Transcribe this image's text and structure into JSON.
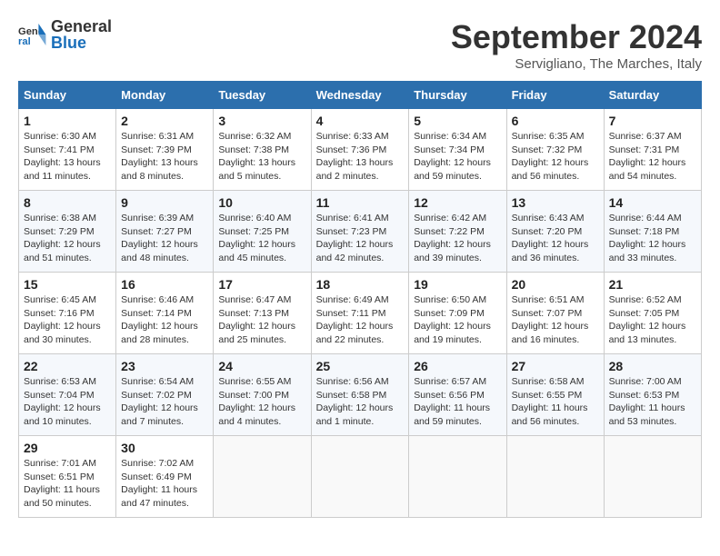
{
  "header": {
    "logo_line1": "General",
    "logo_line2": "Blue",
    "month_title": "September 2024",
    "subtitle": "Servigliano, The Marches, Italy"
  },
  "days_of_week": [
    "Sunday",
    "Monday",
    "Tuesday",
    "Wednesday",
    "Thursday",
    "Friday",
    "Saturday"
  ],
  "weeks": [
    [
      {
        "day": 1,
        "sunrise": "6:30 AM",
        "sunset": "7:41 PM",
        "daylight": "13 hours and 11 minutes."
      },
      {
        "day": 2,
        "sunrise": "6:31 AM",
        "sunset": "7:39 PM",
        "daylight": "13 hours and 8 minutes."
      },
      {
        "day": 3,
        "sunrise": "6:32 AM",
        "sunset": "7:38 PM",
        "daylight": "13 hours and 5 minutes."
      },
      {
        "day": 4,
        "sunrise": "6:33 AM",
        "sunset": "7:36 PM",
        "daylight": "13 hours and 2 minutes."
      },
      {
        "day": 5,
        "sunrise": "6:34 AM",
        "sunset": "7:34 PM",
        "daylight": "12 hours and 59 minutes."
      },
      {
        "day": 6,
        "sunrise": "6:35 AM",
        "sunset": "7:32 PM",
        "daylight": "12 hours and 56 minutes."
      },
      {
        "day": 7,
        "sunrise": "6:37 AM",
        "sunset": "7:31 PM",
        "daylight": "12 hours and 54 minutes."
      }
    ],
    [
      {
        "day": 8,
        "sunrise": "6:38 AM",
        "sunset": "7:29 PM",
        "daylight": "12 hours and 51 minutes."
      },
      {
        "day": 9,
        "sunrise": "6:39 AM",
        "sunset": "7:27 PM",
        "daylight": "12 hours and 48 minutes."
      },
      {
        "day": 10,
        "sunrise": "6:40 AM",
        "sunset": "7:25 PM",
        "daylight": "12 hours and 45 minutes."
      },
      {
        "day": 11,
        "sunrise": "6:41 AM",
        "sunset": "7:23 PM",
        "daylight": "12 hours and 42 minutes."
      },
      {
        "day": 12,
        "sunrise": "6:42 AM",
        "sunset": "7:22 PM",
        "daylight": "12 hours and 39 minutes."
      },
      {
        "day": 13,
        "sunrise": "6:43 AM",
        "sunset": "7:20 PM",
        "daylight": "12 hours and 36 minutes."
      },
      {
        "day": 14,
        "sunrise": "6:44 AM",
        "sunset": "7:18 PM",
        "daylight": "12 hours and 33 minutes."
      }
    ],
    [
      {
        "day": 15,
        "sunrise": "6:45 AM",
        "sunset": "7:16 PM",
        "daylight": "12 hours and 30 minutes."
      },
      {
        "day": 16,
        "sunrise": "6:46 AM",
        "sunset": "7:14 PM",
        "daylight": "12 hours and 28 minutes."
      },
      {
        "day": 17,
        "sunrise": "6:47 AM",
        "sunset": "7:13 PM",
        "daylight": "12 hours and 25 minutes."
      },
      {
        "day": 18,
        "sunrise": "6:49 AM",
        "sunset": "7:11 PM",
        "daylight": "12 hours and 22 minutes."
      },
      {
        "day": 19,
        "sunrise": "6:50 AM",
        "sunset": "7:09 PM",
        "daylight": "12 hours and 19 minutes."
      },
      {
        "day": 20,
        "sunrise": "6:51 AM",
        "sunset": "7:07 PM",
        "daylight": "12 hours and 16 minutes."
      },
      {
        "day": 21,
        "sunrise": "6:52 AM",
        "sunset": "7:05 PM",
        "daylight": "12 hours and 13 minutes."
      }
    ],
    [
      {
        "day": 22,
        "sunrise": "6:53 AM",
        "sunset": "7:04 PM",
        "daylight": "12 hours and 10 minutes."
      },
      {
        "day": 23,
        "sunrise": "6:54 AM",
        "sunset": "7:02 PM",
        "daylight": "12 hours and 7 minutes."
      },
      {
        "day": 24,
        "sunrise": "6:55 AM",
        "sunset": "7:00 PM",
        "daylight": "12 hours and 4 minutes."
      },
      {
        "day": 25,
        "sunrise": "6:56 AM",
        "sunset": "6:58 PM",
        "daylight": "12 hours and 1 minute."
      },
      {
        "day": 26,
        "sunrise": "6:57 AM",
        "sunset": "6:56 PM",
        "daylight": "11 hours and 59 minutes."
      },
      {
        "day": 27,
        "sunrise": "6:58 AM",
        "sunset": "6:55 PM",
        "daylight": "11 hours and 56 minutes."
      },
      {
        "day": 28,
        "sunrise": "7:00 AM",
        "sunset": "6:53 PM",
        "daylight": "11 hours and 53 minutes."
      }
    ],
    [
      {
        "day": 29,
        "sunrise": "7:01 AM",
        "sunset": "6:51 PM",
        "daylight": "11 hours and 50 minutes."
      },
      {
        "day": 30,
        "sunrise": "7:02 AM",
        "sunset": "6:49 PM",
        "daylight": "11 hours and 47 minutes."
      },
      null,
      null,
      null,
      null,
      null
    ]
  ]
}
